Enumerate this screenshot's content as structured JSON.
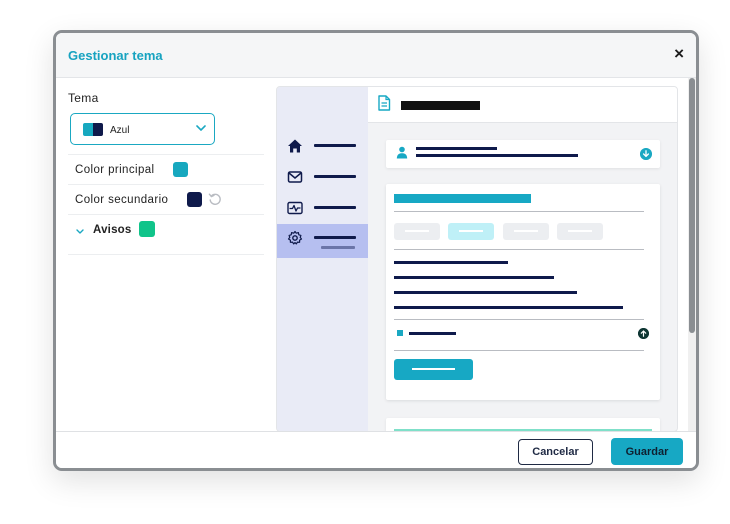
{
  "dialog": {
    "title": "Gestionar tema",
    "close_label": "×"
  },
  "theme": {
    "label": "Tema",
    "selected": "Azul",
    "primary_label": "Color principal",
    "secondary_label": "Color secundario",
    "alerts_label": "Avisos"
  },
  "colors": {
    "primary": "#17a8bf",
    "secondary": "#0f1a4b",
    "alerts": "#10c48a",
    "accent": "#17a8c4",
    "preview_nav_active": "#b6bff0"
  },
  "preview": {
    "nav_icons": [
      "home-icon",
      "mail-icon",
      "activity-icon",
      "gear-icon"
    ],
    "active_nav": "gear-icon",
    "top_icon": "document-icon",
    "card_icons": [
      "person-icon",
      "download-icon",
      "arrow-up-icon"
    ]
  },
  "footer": {
    "cancel_label": "Cancelar",
    "save_label": "Guardar"
  }
}
